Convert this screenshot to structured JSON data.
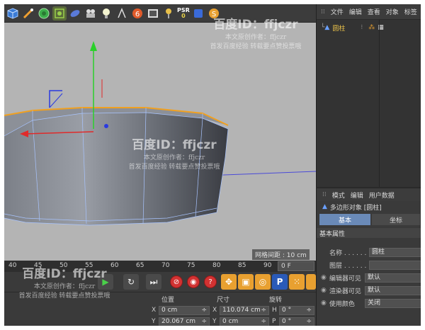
{
  "toolbar": {
    "icons": [
      "cube-icon",
      "pen-icon",
      "subdivision-icon",
      "deformer-icon",
      "environment-icon",
      "camera-icon",
      "light-icon",
      "snap-icon",
      "tag-icon",
      "render-view-icon"
    ],
    "psr_label": "PSR",
    "psr_value": "0",
    "key_value": "4"
  },
  "object_manager": {
    "menu": [
      "文件",
      "编辑",
      "查看",
      "对象",
      "标签"
    ],
    "object_name": "圆柱"
  },
  "viewport": {
    "grid_spacing": "网格间距 : 10 cm"
  },
  "timeline": {
    "ticks": [
      "40",
      "45",
      "50",
      "55",
      "60",
      "65",
      "70",
      "75",
      "80",
      "85",
      "90"
    ],
    "frame": "0 F"
  },
  "coordinates": {
    "headers": [
      "位置",
      "尺寸",
      "旋转"
    ],
    "rows": [
      {
        "axis": "X",
        "pos": "0 cm",
        "size_axis": "X",
        "size": "110.074 cm",
        "rot_axis": "H",
        "rot": "0 °"
      },
      {
        "axis": "Y",
        "pos": "20.067 cm",
        "size_axis": "Y",
        "size": "0 cm",
        "rot_axis": "P",
        "rot": "0 °"
      }
    ]
  },
  "attributes": {
    "menu": [
      "模式",
      "编辑",
      "用户数据"
    ],
    "title": "多边形对象 [圆柱]",
    "tabs": [
      "基本",
      "坐标"
    ],
    "section": "基本属性",
    "props": [
      {
        "label": "名称 . . . . . .",
        "value": "圆柱"
      },
      {
        "label": "图层 . . . . . .",
        "value": ""
      },
      {
        "label": "编辑器可见",
        "value": "默认"
      },
      {
        "label": "渲染器可见",
        "value": "默认"
      },
      {
        "label": "使用颜色",
        "value": "关闭"
      }
    ]
  },
  "watermark": {
    "brand": "百度ID：ffjczr",
    "line1": "本文原创作者：ffjczr",
    "line2": "首发百度经验 转载要点赞投票哦"
  }
}
